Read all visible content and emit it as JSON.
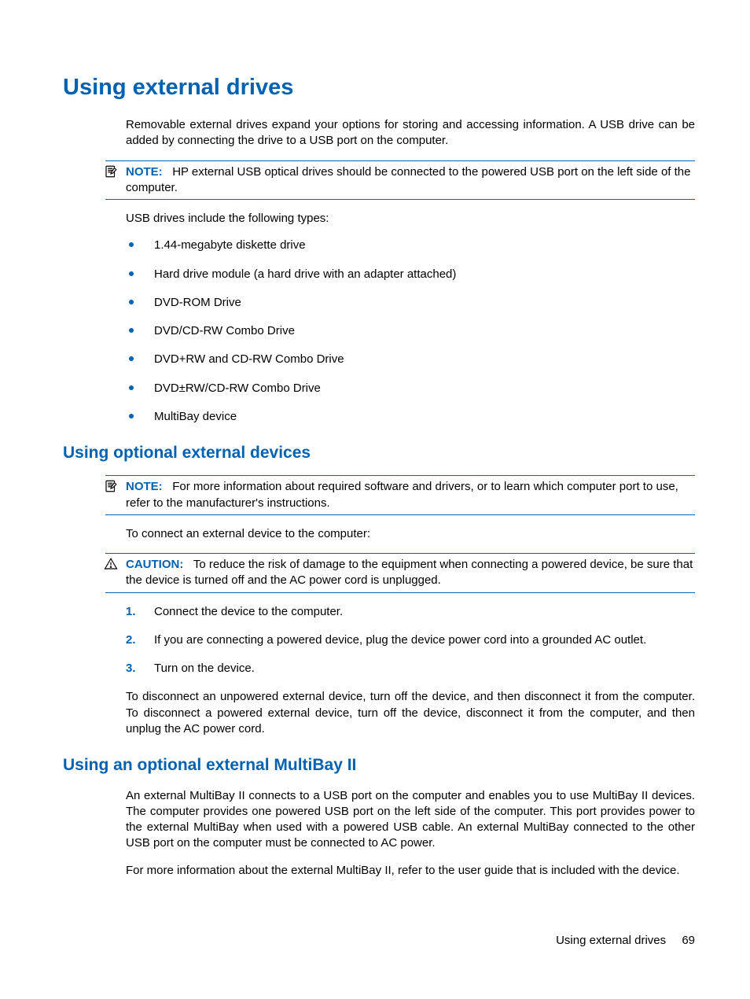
{
  "h1": "Using external drives",
  "intro": "Removable external drives expand your options for storing and accessing information. A USB drive can be added by connecting the drive to a USB port on the computer.",
  "note1": {
    "label": "NOTE:",
    "text": "HP external USB optical drives should be connected to the powered USB port on the left side of the computer."
  },
  "listLead": "USB drives include the following types:",
  "bullets": [
    "1.44-megabyte diskette drive",
    "Hard drive module (a hard drive with an adapter attached)",
    "DVD-ROM Drive",
    "DVD/CD-RW Combo Drive",
    "DVD+RW and CD-RW Combo Drive",
    "DVD±RW/CD-RW Combo Drive",
    "MultiBay device"
  ],
  "h2a": "Using optional external devices",
  "note2": {
    "label": "NOTE:",
    "text": "For more information about required software and drivers, or to learn which computer port to use, refer to the manufacturer's instructions."
  },
  "connectLead": "To connect an external device to the computer:",
  "caution": {
    "label": "CAUTION:",
    "text": "To reduce the risk of damage to the equipment when connecting a powered device, be sure that the device is turned off and the AC power cord is unplugged."
  },
  "steps": [
    "Connect the device to the computer.",
    "If you are connecting a powered device, plug the device power cord into a grounded AC outlet.",
    "Turn on the device."
  ],
  "disconnect": "To disconnect an unpowered external device, turn off the device, and then disconnect it from the computer. To disconnect a powered external device, turn off the device, disconnect it from the computer, and then unplug the AC power cord.",
  "h2b": "Using an optional external MultiBay II",
  "multibay1": "An external MultiBay II connects to a USB port on the computer and enables you to use MultiBay II devices. The computer provides one powered USB port on the left side of the computer. This port provides power to the external MultiBay when used with a powered USB cable. An external MultiBay connected to the other USB port on the computer must be connected to AC power.",
  "multibay2": "For more information about the external MultiBay II, refer to the user guide that is included with the device.",
  "footer": {
    "title": "Using external drives",
    "page": "69"
  }
}
